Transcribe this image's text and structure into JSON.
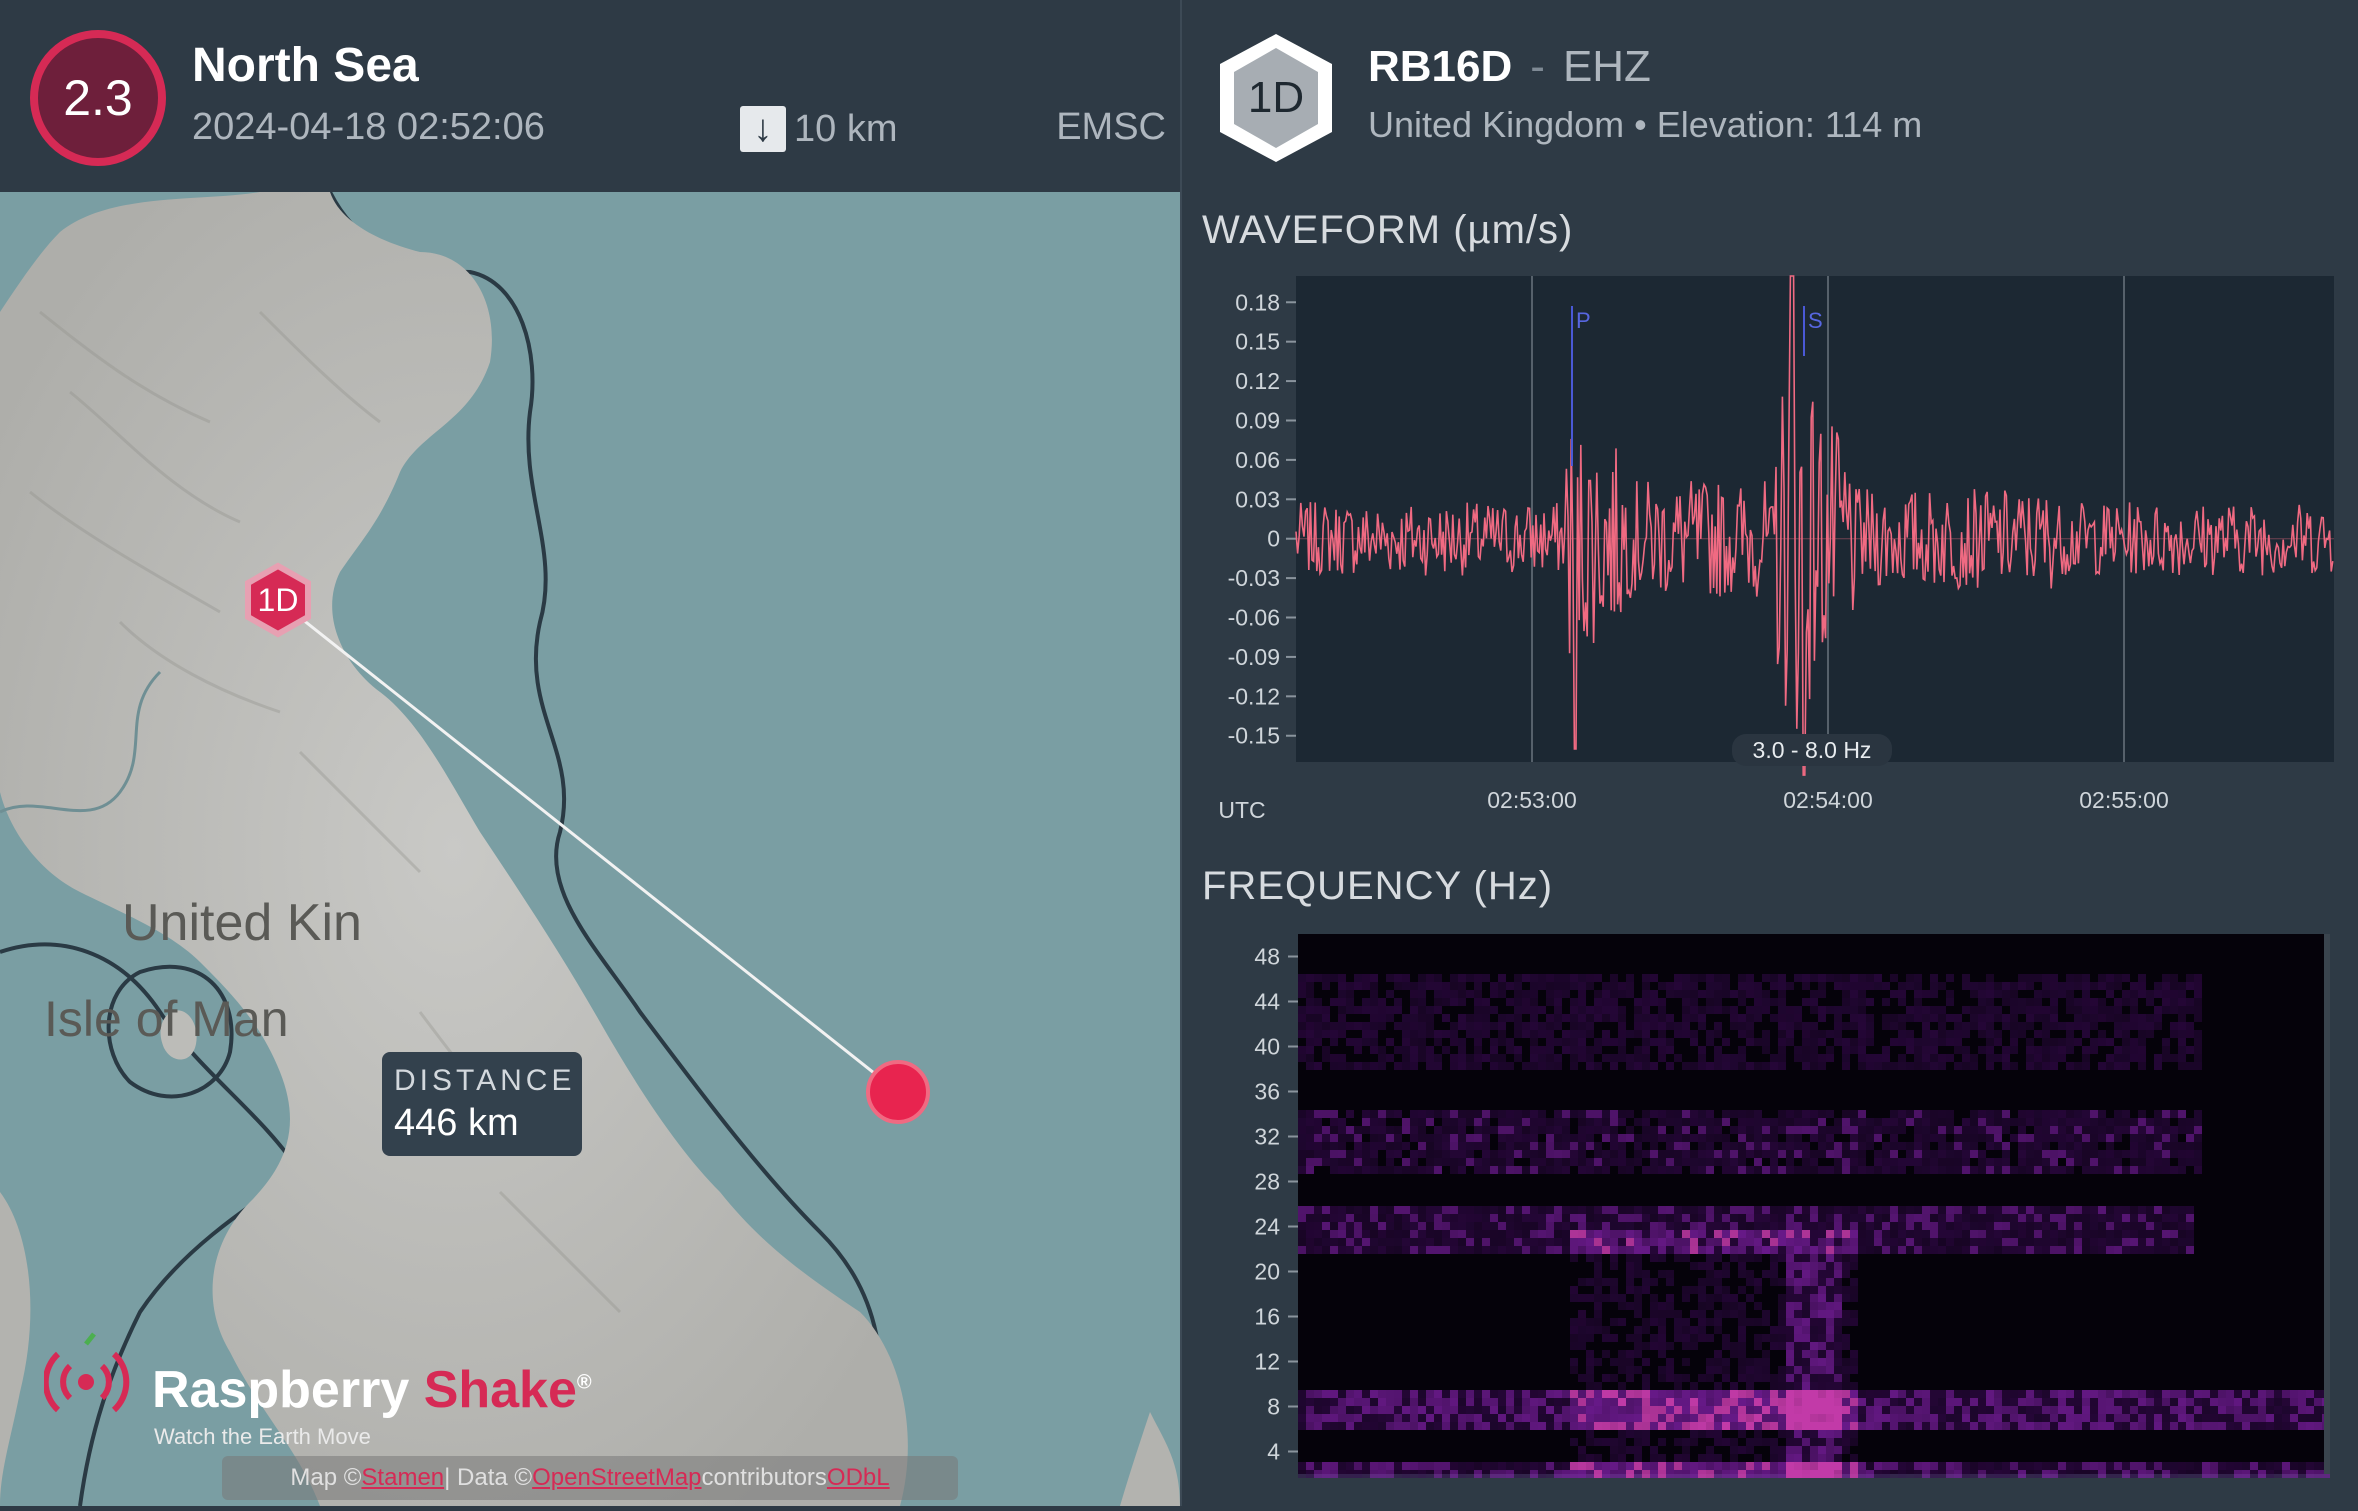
{
  "event": {
    "magnitude": "2.3",
    "region": "North Sea",
    "datetime": "2024-04-18 02:52:06",
    "depth": "10 km",
    "source": "EMSC"
  },
  "station": {
    "code": "1D",
    "name": "RB16D",
    "separator": "-",
    "channel": "EHZ",
    "location": "United Kingdom • Elevation: 114 m"
  },
  "map": {
    "labels": [
      "United Kin",
      "Isle of Man"
    ],
    "distance_label": "DISTANCE",
    "distance_value": "446 km",
    "logo": {
      "brand_a": "Raspberry ",
      "brand_b": "Shake",
      "reg": "®",
      "tagline": "Watch the Earth Move"
    },
    "attribution": {
      "prefix": "Map © ",
      "map_link": "Stamen",
      "mid": " | Data © ",
      "data_link": "OpenStreetMap",
      "suffix": " contributors ",
      "license_link": "ODbL"
    }
  },
  "waveform": {
    "title": "WAVEFORM (µm/s)",
    "timezone": "UTC",
    "filter": "3.0 - 8.0 Hz",
    "p_label": "P",
    "s_label": "S"
  },
  "frequency": {
    "title": "FREQUENCY (Hz)"
  },
  "chart_data": [
    {
      "type": "line",
      "title": "WAVEFORM (µm/s)",
      "x": [
        "02:53:00",
        "02:54:00",
        "02:55:00"
      ],
      "yticks": [
        0.18,
        0.15,
        0.12,
        0.09,
        0.06,
        0.03,
        0,
        -0.03,
        -0.06,
        -0.09,
        -0.12,
        -0.15
      ],
      "ylim": [
        -0.17,
        0.2
      ],
      "series": [
        {
          "name": "EHZ",
          "color": "#f06a82"
        }
      ],
      "annotations": [
        "P",
        "S",
        "3.0 - 8.0 Hz"
      ],
      "grid": true
    },
    {
      "type": "heatmap",
      "title": "FREQUENCY (Hz)",
      "yticks": [
        48,
        44,
        40,
        36,
        32,
        28,
        24,
        20,
        16,
        12,
        8,
        4
      ],
      "ylim": [
        2,
        50
      ],
      "colormap": [
        "#05020a",
        "#3a0a55",
        "#7a1ea0",
        "#c23aa8"
      ]
    }
  ]
}
